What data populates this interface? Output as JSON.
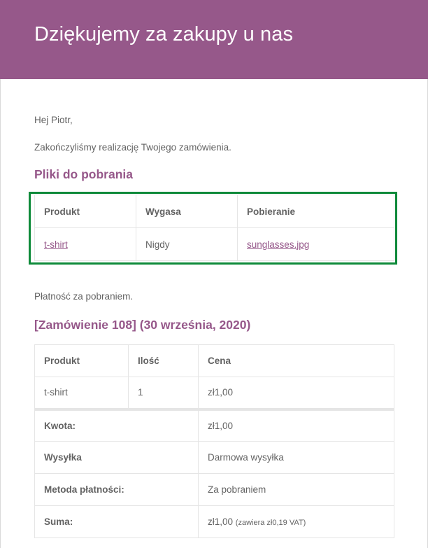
{
  "header": {
    "title": "Dziękujemy za zakupy u nas"
  },
  "body": {
    "greeting": "Hej Piotr,",
    "intro": "Zakończyliśmy realizację Twojego zamówienia.",
    "payment_note": "Płatność za pobraniem."
  },
  "downloads": {
    "title": "Pliki do pobrania",
    "headers": [
      "Produkt",
      "Wygasa",
      "Pobieranie"
    ],
    "row": {
      "product": "t-shirt",
      "expires": "Nigdy",
      "file": "sunglasses.jpg"
    }
  },
  "order": {
    "title": "[Zamówienie 108] (30 września, 2020)",
    "headers": [
      "Produkt",
      "Ilość",
      "Cena"
    ],
    "item": {
      "product": "t-shirt",
      "qty": "1",
      "price": "zł1,00"
    },
    "totals": [
      {
        "label": "Kwota:",
        "value": "zł1,00"
      },
      {
        "label": "Wysyłka",
        "value": "Darmowa wysyłka"
      },
      {
        "label": "Metoda płatności:",
        "value": "Za pobraniem"
      },
      {
        "label": "Suma:",
        "value": "zł1,00",
        "note": "(zawiera zł0,19 VAT)"
      }
    ]
  },
  "colors": {
    "brand": "#96588a",
    "highlight": "#0e8a3a",
    "text": "#636363"
  }
}
